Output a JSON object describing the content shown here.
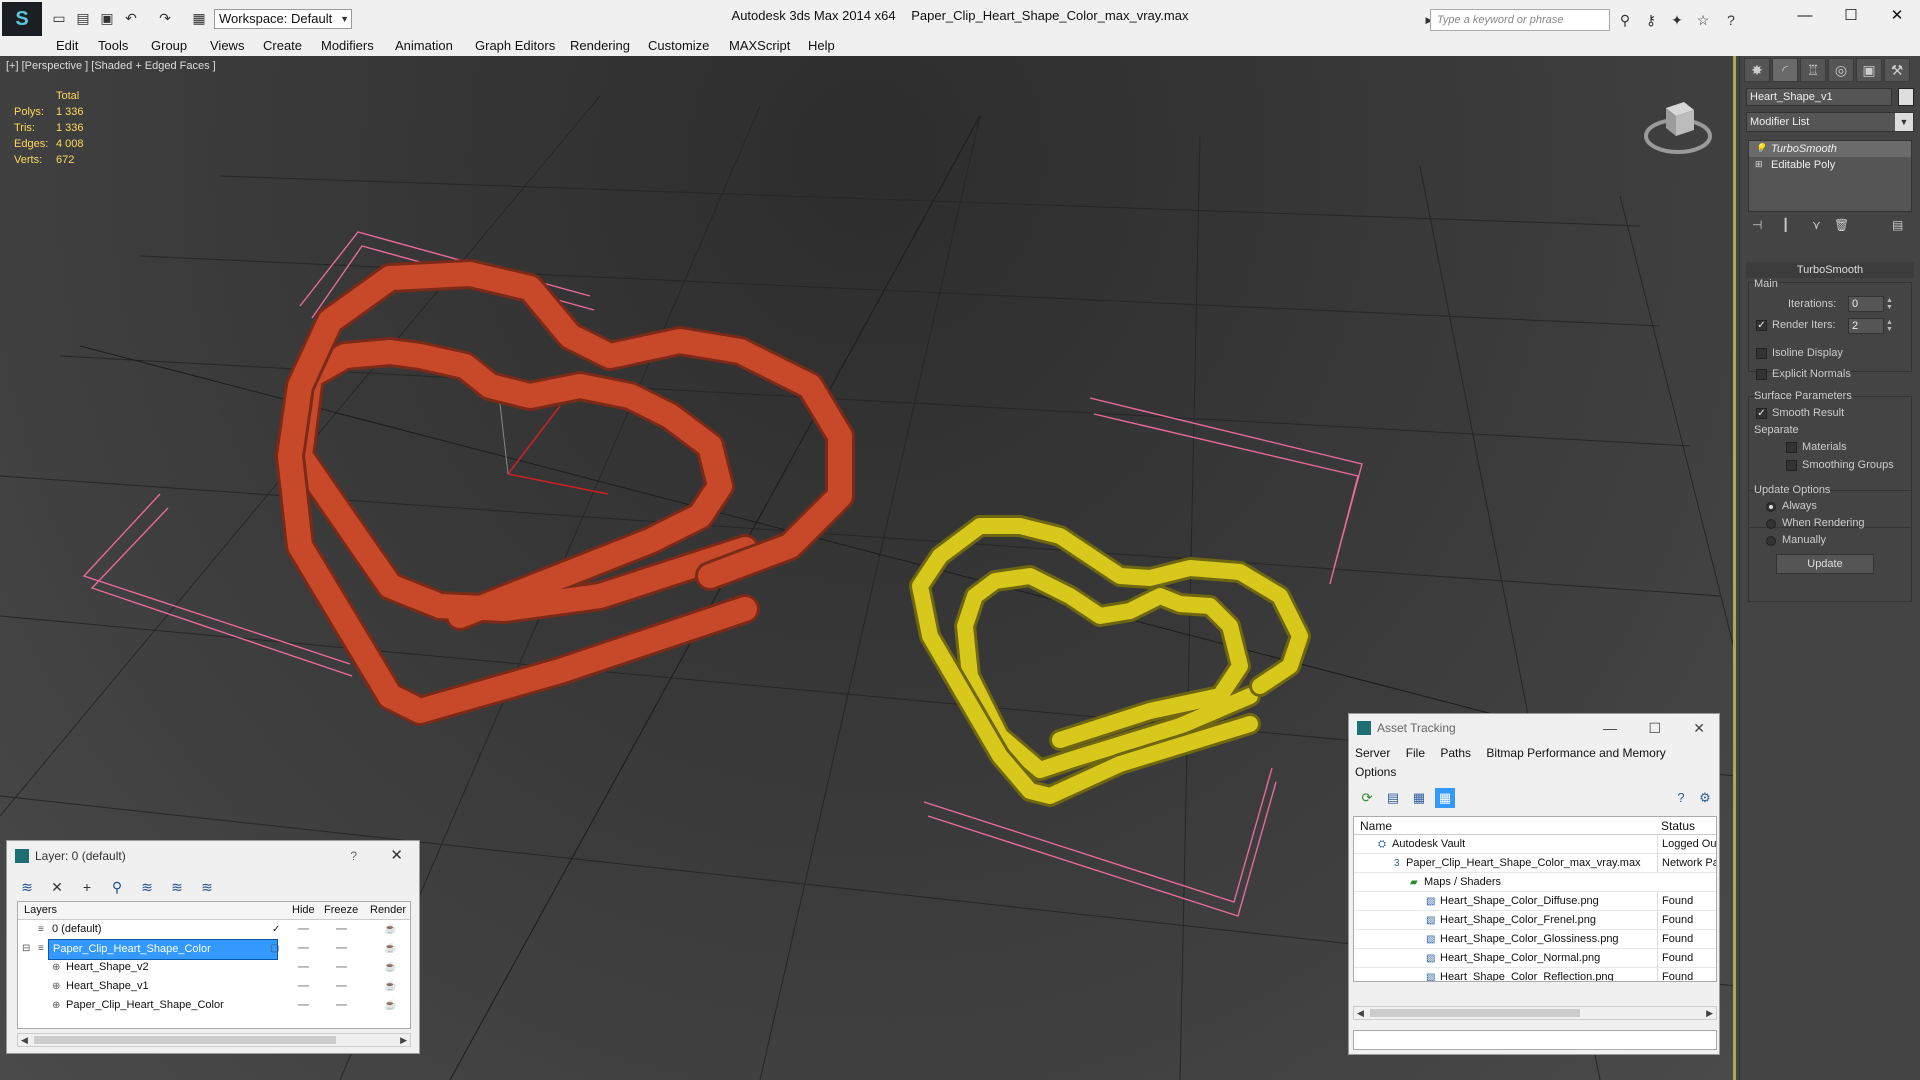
{
  "titlebar": {
    "workspace": "Workspace: Default",
    "app_name": "Autodesk 3ds Max  2014 x64",
    "file_name": "Paper_Clip_Heart_Shape_Color_max_vray.max",
    "search_placeholder": "Type a keyword or phrase",
    "icons": [
      "new-file-icon",
      "open-icon",
      "save-icon",
      "undo-icon",
      "redo-icon",
      "project-icon",
      "binoculars-icon",
      "key-icon",
      "star-icon",
      "help-icon"
    ]
  },
  "menubar": [
    "Edit",
    "Tools",
    "Group",
    "Views",
    "Create",
    "Modifiers",
    "Animation",
    "Graph Editors",
    "Rendering",
    "Customize",
    "MAXScript",
    "Help"
  ],
  "viewport": {
    "label": "[+] [Perspective ] [Shaded + Edged Faces ]",
    "stats": {
      "total_label": "Total",
      "rows": [
        {
          "label": "Polys:",
          "value": "1 336"
        },
        {
          "label": "Tris:",
          "value": "1 336"
        },
        {
          "label": "Edges:",
          "value": "4 008"
        },
        {
          "label": "Verts:",
          "value": "672"
        }
      ]
    },
    "colors": {
      "red_clip": "#c8482a",
      "yellow_clip": "#d8c81c",
      "selection": "#e8609a"
    }
  },
  "command_panel": {
    "object_name": "Heart_Shape_v1",
    "modifier_list": "Modifier List",
    "stack": [
      "TurboSmooth",
      "Editable Poly"
    ],
    "turbosmooth": {
      "title": "TurboSmooth",
      "main_label": "Main",
      "iterations_label": "Iterations:",
      "iterations": "0",
      "render_iters_label": "Render Iters:",
      "render_iters": "2",
      "isoline": "Isoline Display",
      "explicit_normals": "Explicit Normals",
      "surface_params": "Surface Parameters",
      "smooth_result": "Smooth Result",
      "separate": "Separate",
      "materials": "Materials",
      "smoothing_groups": "Smoothing Groups",
      "update_options": "Update Options",
      "always": "Always",
      "when_rendering": "When Rendering",
      "manually": "Manually",
      "update": "Update"
    }
  },
  "layer_window": {
    "title": "Layer: 0 (default)",
    "help": "?",
    "columns": [
      "Layers",
      "Hide",
      "Freeze",
      "Render"
    ],
    "rows": [
      {
        "name": "0 (default)",
        "indent": 0
      },
      {
        "name": "Paper_Clip_Heart_Shape_Color",
        "indent": 0
      },
      {
        "name": "Heart_Shape_v2",
        "indent": 1
      },
      {
        "name": "Heart_Shape_v1",
        "indent": 1
      },
      {
        "name": "Paper_Clip_Heart_Shape_Color",
        "indent": 1
      }
    ]
  },
  "asset_window": {
    "title": "Asset Tracking",
    "menu": [
      "Server",
      "File",
      "Paths",
      "Bitmap Performance and Memory",
      "Options"
    ],
    "columns": [
      "Name",
      "Status"
    ],
    "rows": [
      {
        "name": "Autodesk Vault",
        "status": "Logged Ou"
      },
      {
        "name": "Paper_Clip_Heart_Shape_Color_max_vray.max",
        "status": "Network Pa"
      },
      {
        "name": "Maps / Shaders",
        "status": ""
      },
      {
        "name": "Heart_Shape_Color_Diffuse.png",
        "status": "Found"
      },
      {
        "name": "Heart_Shape_Color_Frenel.png",
        "status": "Found"
      },
      {
        "name": "Heart_Shape_Color_Glossiness.png",
        "status": "Found"
      },
      {
        "name": "Heart_Shape_Color_Normal.png",
        "status": "Found"
      },
      {
        "name": "Heart_Shape_Color_Reflection.png",
        "status": "Found"
      }
    ]
  }
}
